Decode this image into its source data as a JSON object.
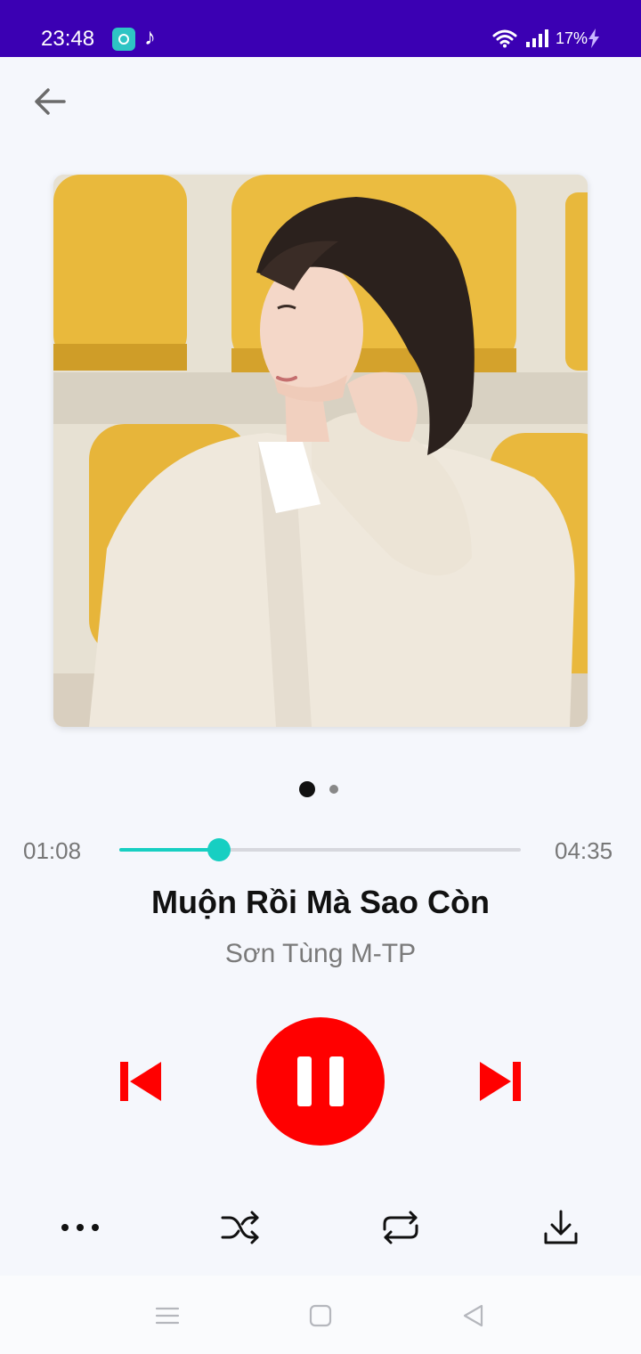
{
  "status_bar": {
    "time": "23:48",
    "battery": "17%",
    "background_color": "#3b00b3",
    "icons": [
      "app-notification-icon",
      "music-note-icon",
      "wifi-icon",
      "signal-icon",
      "charging-icon"
    ]
  },
  "header": {
    "back_icon": "arrow-left-icon"
  },
  "album": {
    "art": "album-cover-photo"
  },
  "pager": {
    "current_page": 1,
    "total_pages": 2
  },
  "player": {
    "current_time": "01:08",
    "total_time": "04:35",
    "progress_fraction": 0.248,
    "accent_color": "#17cfc2",
    "song_title": "Muộn Rồi Mà Sao Còn",
    "artist": "Sơn Tùng M-TP",
    "control_color": "#ff0000",
    "state": "playing"
  },
  "actions": {
    "icons": [
      "more-icon",
      "shuffle-icon",
      "repeat-icon",
      "download-icon"
    ]
  },
  "nav_bar": {
    "icons": [
      "menu-icon",
      "home-icon",
      "back-triangle-icon"
    ]
  }
}
